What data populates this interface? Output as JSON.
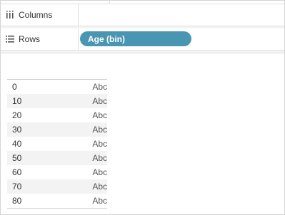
{
  "shelves": {
    "columns": {
      "label": "Columns",
      "icon": "columns-icon",
      "pills": []
    },
    "rows": {
      "label": "Rows",
      "icon": "rows-icon",
      "pills": [
        "Age (bin)"
      ]
    }
  },
  "colors": {
    "pill": "#4996b2",
    "stripe": "#f3f3f3"
  },
  "table": {
    "rows": [
      {
        "bin": "0",
        "value": "Abc"
      },
      {
        "bin": "10",
        "value": "Abc"
      },
      {
        "bin": "20",
        "value": "Abc"
      },
      {
        "bin": "30",
        "value": "Abc"
      },
      {
        "bin": "40",
        "value": "Abc"
      },
      {
        "bin": "50",
        "value": "Abc"
      },
      {
        "bin": "60",
        "value": "Abc"
      },
      {
        "bin": "70",
        "value": "Abc"
      },
      {
        "bin": "80",
        "value": "Abc"
      }
    ]
  }
}
